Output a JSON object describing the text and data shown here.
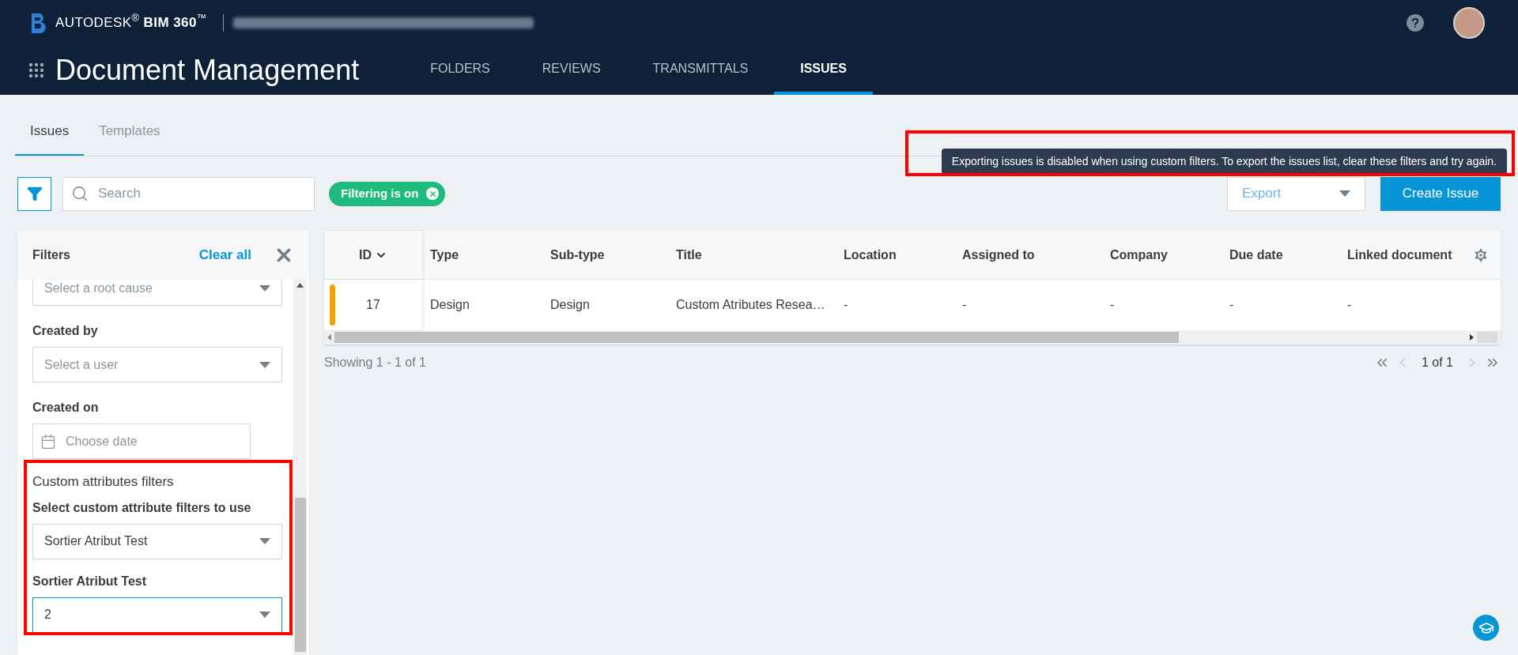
{
  "header": {
    "brand": "AUTODESK$^{®}$ **BIM 360**$^{™}$",
    "app_title": "Document Management",
    "nav": [
      {
        "label": "FOLDERS",
        "selected": false
      },
      {
        "label": "REVIEWS",
        "selected": false
      },
      {
        "label": "TRANSMITTALS",
        "selected": false
      },
      {
        "label": "ISSUES",
        "selected": true
      }
    ]
  },
  "subtabs": [
    {
      "label": "Issues",
      "selected": true
    },
    {
      "label": "Templates",
      "selected": false
    }
  ],
  "toolbar": {
    "search_placeholder": "Search",
    "filter_chip": "Filtering is on",
    "export": {
      "label": "Export",
      "disabled": true
    },
    "create_button": "Create Issue"
  },
  "tooltip": "Exporting issues is disabled when using custom filters. To export the issues list, clear these filters and try again.",
  "filters": {
    "title": "Filters",
    "clear_all": "Clear all",
    "fields": [
      {
        "kind": "select",
        "placeholder": "Select a root cause"
      },
      {
        "kind": "select",
        "label": "Created by",
        "placeholder": "Select a user"
      },
      {
        "kind": "date",
        "label": "Created on",
        "placeholder": "Choose date"
      }
    ],
    "custom": {
      "heading": "Custom attributes filters",
      "label": "Select custom attribute filters to use",
      "value": "Sortier Atribut Test",
      "attribute": {
        "label": "Sortier Atribut Test",
        "value": "2",
        "focused": true
      }
    }
  },
  "table": {
    "columns": [
      "ID",
      "Type",
      "Sub-type",
      "Title",
      "Location",
      "Assigned to",
      "Company",
      "Due date",
      "Linked document"
    ],
    "rows": [
      {
        "color": "#f5a300",
        "cells": [
          "17",
          "Design",
          "Design",
          "Custom Atributes Resea…",
          "-",
          "-",
          "-",
          "-",
          "-"
        ]
      }
    ]
  },
  "pagination": {
    "showing": "Showing 1 - 1 of 1",
    "page": "1 of 1"
  }
}
